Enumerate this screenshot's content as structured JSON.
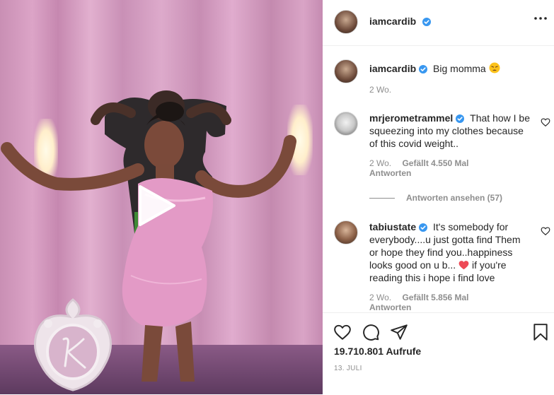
{
  "post": {
    "username": "iamcardib",
    "caption_username": "iamcardib",
    "caption_text": "Big momma",
    "caption_emoji": "weary-face-emoji",
    "caption_time": "2 Wo."
  },
  "comments": [
    {
      "username": "mrjerometrammel",
      "line1": "That how I be",
      "line2": "squeezing into my clothes because",
      "line3": "of this covid weight..",
      "time": "2 Wo.",
      "likes": "Gefällt 4.550 Mal",
      "reply": "Antworten",
      "view_replies": "Antworten ansehen (57)"
    },
    {
      "username": "tabiustate",
      "line1": "It's somebody for",
      "line2": "everybody....u just gotta find Them",
      "line3": "or hope they find you..happiness",
      "line4": "looks good on u b...",
      "line5_after_heart": "if you're",
      "line6": "reading this i hope i find love",
      "time": "2 Wo.",
      "likes": "Gefällt 5.856 Mal",
      "reply": "Antworten"
    }
  ],
  "footer": {
    "views": "19.710.801 Aufrufe",
    "date": "13. JULI"
  },
  "icons": {
    "verified": "verified-badge-icon",
    "more": "more-options-icon",
    "like": "heart-icon",
    "comment": "comment-icon",
    "share": "share-icon",
    "save": "bookmark-icon",
    "play": "play-icon"
  },
  "colors": {
    "verified": "#3897f0",
    "text": "#262626",
    "muted": "#8e8e8e",
    "heart_red": "#ed4956"
  }
}
